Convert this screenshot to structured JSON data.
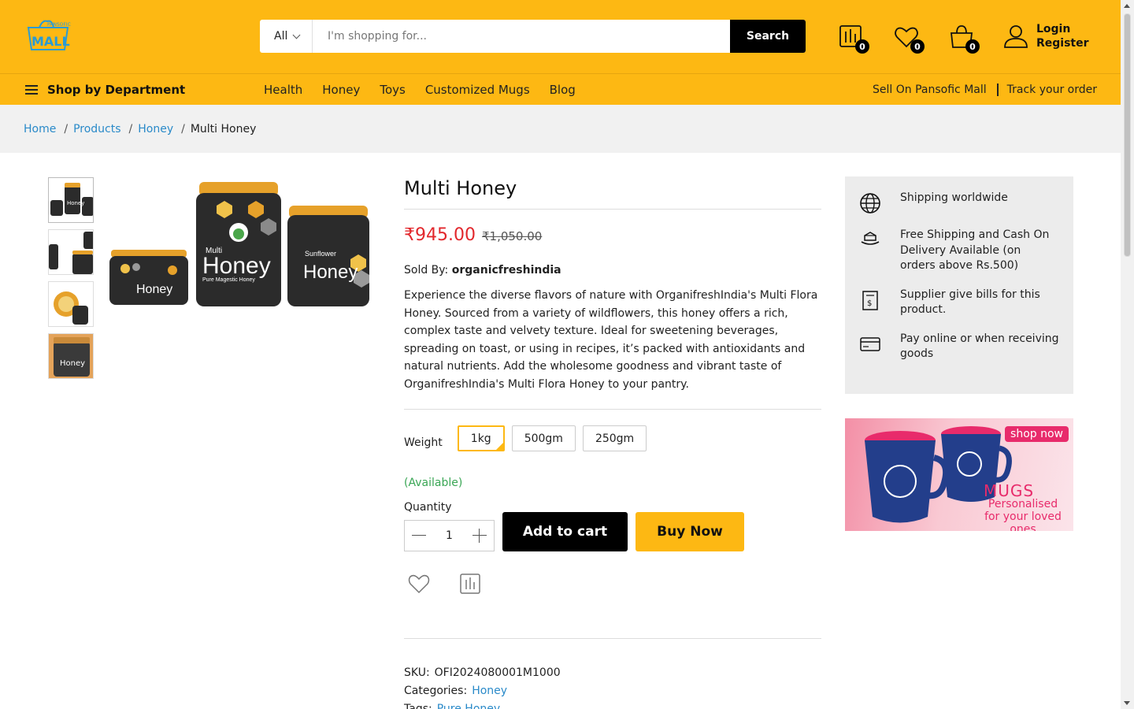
{
  "header": {
    "logo_text": "MALL",
    "search": {
      "category": "All",
      "placeholder": "I'm shopping for...",
      "button": "Search"
    },
    "compare_count": "0",
    "wishlist_count": "0",
    "cart_count": "0",
    "login": "Login",
    "register": "Register"
  },
  "nav": {
    "department": "Shop by Department",
    "links": [
      "Health",
      "Honey",
      "Toys",
      "Customized Mugs",
      "Blog"
    ],
    "sell": "Sell On Pansofic Mall",
    "track": "Track your order"
  },
  "breadcrumb": {
    "items": [
      "Home",
      "Products",
      "Honey"
    ],
    "separator": "/",
    "current": "Multi Honey"
  },
  "product": {
    "title": "Multi Honey",
    "price": "₹945.00",
    "old_price": "₹1,050.00",
    "sold_by_label": "Sold By:",
    "seller": "organicfreshindia",
    "description": "Experience the diverse flavors of nature with OrganifreshIndia's Multi Flora Honey. Sourced from a variety of wildflowers, this honey offers a rich, complex taste and velvety texture. Ideal for sweetening beverages, spreading on toast, or using in recipes, it’s packed with antioxidants and natural nutrients. Add the wholesome goodness and vibrant taste of OrganifreshIndia's Multi Flora Honey to your pantry.",
    "weight_label": "Weight",
    "weights": [
      "1kg",
      "500gm",
      "250gm"
    ],
    "selected_weight": "1kg",
    "availability": "(Available)",
    "quantity_label": "Quantity",
    "quantity": "1",
    "add_to_cart": "Add to cart",
    "buy_now": "Buy Now",
    "sku_label": "SKU:",
    "sku": "OFI2024080001M1000",
    "categories_label": "Categories:",
    "category": "Honey",
    "tags_label": "Tags:",
    "tag": "Pure Honey",
    "jar_labels": {
      "big": "Honey",
      "big_top": "Multi",
      "big_sub": "Pure Magestic Honey",
      "right": "Honey",
      "right_top": "Sunflower",
      "left": "Honey"
    }
  },
  "features": [
    {
      "icon": "globe-icon",
      "text": "Shipping worldwide"
    },
    {
      "icon": "delivery-hand-icon",
      "text": "Free Shipping and Cash On Delivery Available (on orders above Rs.500)"
    },
    {
      "icon": "bill-icon",
      "text": "Supplier give bills for this product."
    },
    {
      "icon": "card-icon",
      "text": "Pay online or when receiving goods"
    }
  ],
  "banner": {
    "button": "shop now",
    "title": "MUGS",
    "subtitle_1": "Personalised",
    "subtitle_2": "for your loved ones"
  },
  "colors": {
    "brand": "#fdb813",
    "price": "#e2272c",
    "link": "#2a8ac9",
    "available": "#3aa655"
  }
}
